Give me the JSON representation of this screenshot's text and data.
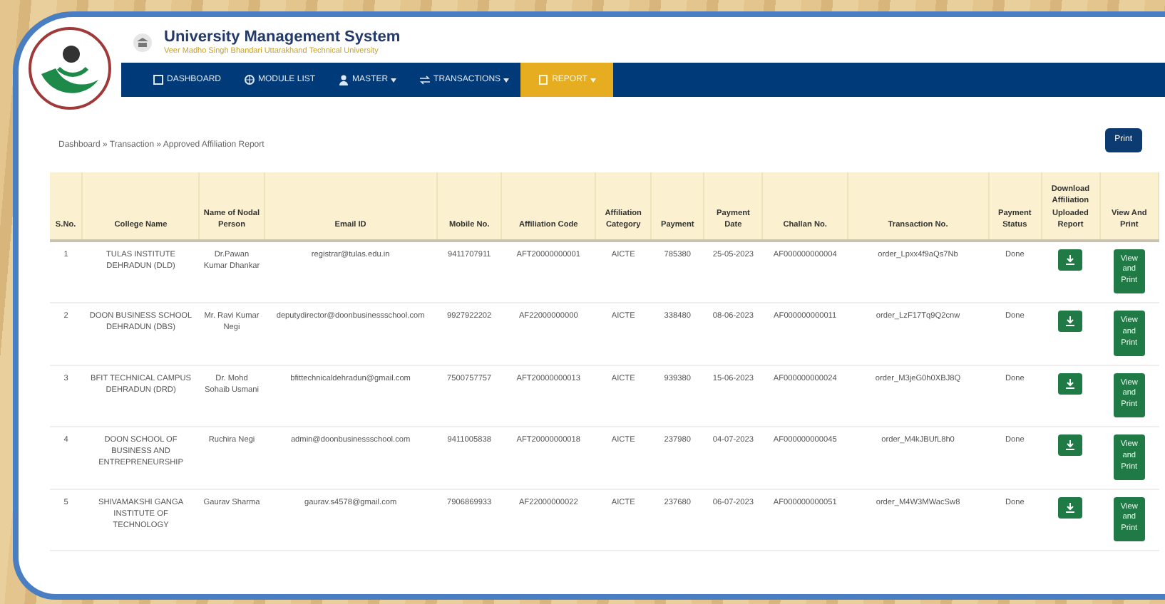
{
  "header": {
    "title": "University Management System",
    "subtitle": "Veer Madho Singh Bhandari Uttarakhand Technical University"
  },
  "nav": [
    {
      "label": "DASHBOARD",
      "dropdown": false,
      "selected": false
    },
    {
      "label": "MODULE LIST",
      "dropdown": false,
      "selected": false
    },
    {
      "label": "MASTER",
      "dropdown": true,
      "selected": false
    },
    {
      "label": "TRANSACTIONS",
      "dropdown": true,
      "selected": false
    },
    {
      "label": "REPORT",
      "dropdown": true,
      "selected": true
    }
  ],
  "breadcrumb": "Dashboard » Transaction » Approved Affiliation Report",
  "print_button": "Print",
  "table": {
    "columns": [
      "S.No.",
      "College Name",
      "Name of Nodal Person",
      "Email ID",
      "Mobile No.",
      "Affiliation Code",
      "Affiliation Category",
      "Payment",
      "Payment Date",
      "Challan No.",
      "Transaction No.",
      "Payment Status",
      "Download Affiliation Uploaded Report",
      "View And Print"
    ],
    "rows": [
      {
        "cells": [
          "1",
          "TULAS INSTITUTE DEHRADUN (DLD)",
          "Dr.Pawan Kumar Dhankar",
          "registrar@tulas.edu.in",
          "9411707911",
          "AFT20000000001",
          "AICTE",
          "785380",
          "25-05-2023",
          "AF000000000004",
          "order_Lpxx4f9aQs7Nb",
          "Done"
        ],
        "view": "View and Print"
      },
      {
        "cells": [
          "2",
          "DOON BUSINESS SCHOOL DEHRADUN (DBS)",
          "Mr. Ravi Kumar Negi",
          "deputydirector@doonbusinessschool.com",
          "9927922202",
          "AF22000000000",
          "AICTE",
          "338480",
          "08-06-2023",
          "AF000000000011",
          "order_LzF17Tq9Q2cnw",
          "Done"
        ],
        "view": "View and Print"
      },
      {
        "cells": [
          "3",
          "BFIT TECHNICAL CAMPUS DEHRADUN (DRD)",
          "Dr. Mohd Sohaib Usmani",
          "bfittechnicaldehradun@gmail.com",
          "7500757757",
          "AFT20000000013",
          "AICTE",
          "939380",
          "15-06-2023",
          "AF000000000024",
          "order_M3jeG0h0XBJ8Q",
          "Done"
        ],
        "view": "View and Print"
      },
      {
        "cells": [
          "4",
          "DOON SCHOOL OF BUSINESS AND ENTREPRENEURSHIP",
          "Ruchira Negi",
          "admin@doonbusinessschool.com",
          "9411005838",
          "AFT20000000018",
          "AICTE",
          "237980",
          "04-07-2023",
          "AF000000000045",
          "order_M4kJBUfL8h0",
          "Done"
        ],
        "view": "View and Print"
      },
      {
        "cells": [
          "5",
          "SHIVAMAKSHI GANGA INSTITUTE OF TECHNOLOGY",
          "Gaurav Sharma",
          "gaurav.s4578@gmail.com",
          "7906869933",
          "AF22000000022",
          "AICTE",
          "237680",
          "06-07-2023",
          "AF000000000051",
          "order_M4W3MWacSw8",
          "Done"
        ],
        "view": "View and Print"
      }
    ]
  }
}
